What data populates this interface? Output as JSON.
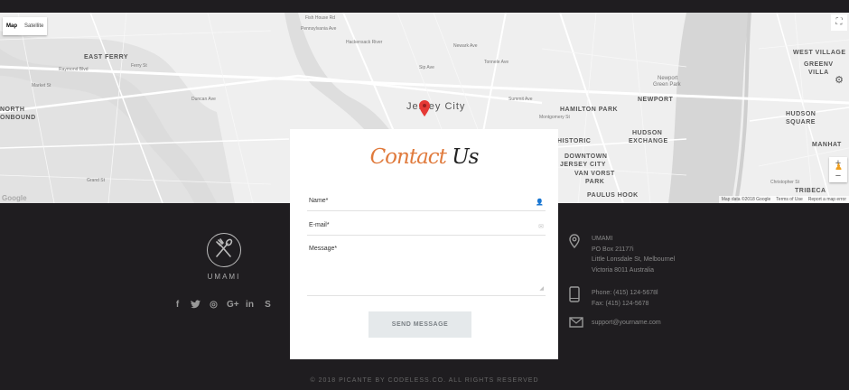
{
  "map": {
    "type_map": "Map",
    "type_satellite": "Satellite",
    "city": "Jersey City",
    "labels": [
      "EAST FERRY",
      "NORTH",
      "ONBOUND",
      "HISTORIC",
      "DOWNTOWN",
      "JERSEY CITY",
      "VAN VORST",
      "PARK",
      "HAMILTON PARK",
      "HUDSON",
      "EXCHANGE",
      "NEWPORT",
      "HUDSON",
      "SQUARE",
      "WEST VILLAGE",
      "GREENV",
      "VILLA",
      "TRIBECA",
      "MANHAT",
      "PAULUS HOOK",
      "Newport",
      "Green Park"
    ],
    "streets": [
      "Fish House Rd",
      "Pennsylvania Ave",
      "Hackensack River",
      "Newark Ave",
      "Sip Ave",
      "Tonnele Ave",
      "Summit Ave",
      "Raymond Blvd",
      "Ferry St",
      "Market St",
      "Duncan Ave",
      "Grand St",
      "Montgomery St",
      "Christopher St"
    ],
    "attribution": [
      "Map data ©2018 Google",
      "Terms of Use",
      "Report a map error"
    ],
    "google": "Google",
    "zoom_in": "+",
    "zoom_out": "−"
  },
  "card": {
    "title_a": "Contact",
    "title_b": " Us",
    "name_label": "Name*",
    "email_label": "E-mail*",
    "message_label": "Message*",
    "submit": "SEND MESSAGE"
  },
  "brand": {
    "name": "UMAMI"
  },
  "socials": [
    "f",
    "t",
    "◎",
    "G+",
    "in",
    "S"
  ],
  "contact": {
    "address": [
      "UMAMI",
      "PO Box 21177i",
      "Little Lonsdale St, Melbournel",
      "Victoria 8011 Australia"
    ],
    "phone": [
      "Phone: (415) 124-5678l",
      "Fax: (415) 124-5678"
    ],
    "email": "support@yourname.com"
  },
  "footer": {
    "copyright": "© 2018 PICANTE BY CODELESS.CO. ALL RIGHTS RESERVED"
  },
  "colors": {
    "accent": "#e07a3c",
    "footer_bg": "#1f1d20"
  }
}
